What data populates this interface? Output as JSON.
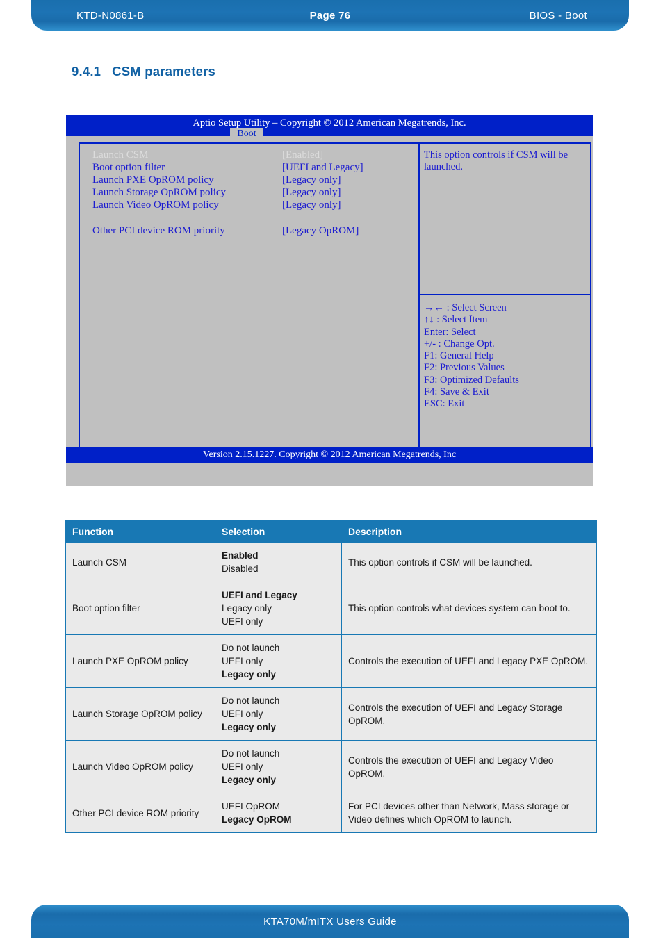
{
  "header": {
    "doc_id": "KTD-N0861-B",
    "page": "Page 76",
    "section": "BIOS - Boot"
  },
  "heading": {
    "number": "9.4.1",
    "title": "CSM parameters"
  },
  "bios": {
    "title": "Aptio Setup Utility  –  Copyright © 2012 American Megatrends, Inc.",
    "tab": "Boot",
    "options": [
      {
        "name": "Launch CSM",
        "value": "[Enabled]",
        "selected": true
      },
      {
        "name": "Boot option filter",
        "value": "[UEFI and Legacy]",
        "selected": false
      },
      {
        "name": "Launch PXE OpROM policy",
        "value": "[Legacy only]",
        "selected": false
      },
      {
        "name": "Launch Storage OpROM policy",
        "value": "[Legacy only]",
        "selected": false
      },
      {
        "name": "Launch Video OpROM policy",
        "value": "[Legacy only]",
        "selected": false
      },
      {
        "name": "Other PCI device ROM priority",
        "value": "[Legacy OpROM]",
        "selected": false
      }
    ],
    "help_text": "This option controls if CSM will be launched.",
    "keys": [
      "→←  : Select Screen",
      "↑↓ : Select Item",
      "Enter: Select",
      "+/- : Change Opt.",
      "F1: General Help",
      "F2: Previous Values",
      "F3: Optimized Defaults",
      "F4: Save & Exit",
      "ESC: Exit"
    ],
    "version": "Version 2.15.1227. Copyright © 2012 American Megatrends, Inc"
  },
  "table": {
    "columns": [
      "Function",
      "Selection",
      "Description"
    ],
    "rows": [
      {
        "function": "Launch CSM",
        "selections": [
          {
            "text": "Enabled",
            "bold": true
          },
          {
            "text": "Disabled",
            "bold": false
          }
        ],
        "description": "This option controls if CSM will be launched."
      },
      {
        "function": "Boot option filter",
        "selections": [
          {
            "text": "UEFI and Legacy",
            "bold": true
          },
          {
            "text": "Legacy only",
            "bold": false
          },
          {
            "text": "UEFI only",
            "bold": false
          }
        ],
        "description": "This option controls what devices system can boot to."
      },
      {
        "function": "Launch PXE OpROM policy",
        "selections": [
          {
            "text": "Do not launch",
            "bold": false
          },
          {
            "text": "UEFI only",
            "bold": false
          },
          {
            "text": "Legacy only",
            "bold": true
          }
        ],
        "description": "Controls the execution of UEFI and Legacy PXE OpROM."
      },
      {
        "function": "Launch Storage OpROM policy",
        "selections": [
          {
            "text": "Do not launch",
            "bold": false
          },
          {
            "text": "UEFI only",
            "bold": false
          },
          {
            "text": "Legacy only",
            "bold": true
          }
        ],
        "description": "Controls the execution of UEFI and Legacy Storage OpROM."
      },
      {
        "function": "Launch Video OpROM policy",
        "selections": [
          {
            "text": "Do not launch",
            "bold": false
          },
          {
            "text": "UEFI only",
            "bold": false
          },
          {
            "text": "Legacy only",
            "bold": true
          }
        ],
        "description": "Controls the execution of UEFI and Legacy Video OpROM."
      },
      {
        "function": "Other PCI device ROM priority",
        "selections": [
          {
            "text": "UEFI OpROM",
            "bold": false
          },
          {
            "text": "Legacy OpROM",
            "bold": true
          }
        ],
        "description": "For PCI devices other than Network, Mass storage or Video defines which OpROM to launch."
      }
    ]
  },
  "footer": {
    "text": "KTA70M/mITX Users Guide"
  },
  "colors": {
    "brand_blue": "#1878b4",
    "heading_blue": "#1161a4",
    "bios_blue": "#0020c8",
    "bios_gray": "#c0c0c0",
    "table_row_bg": "#eaeaea"
  }
}
